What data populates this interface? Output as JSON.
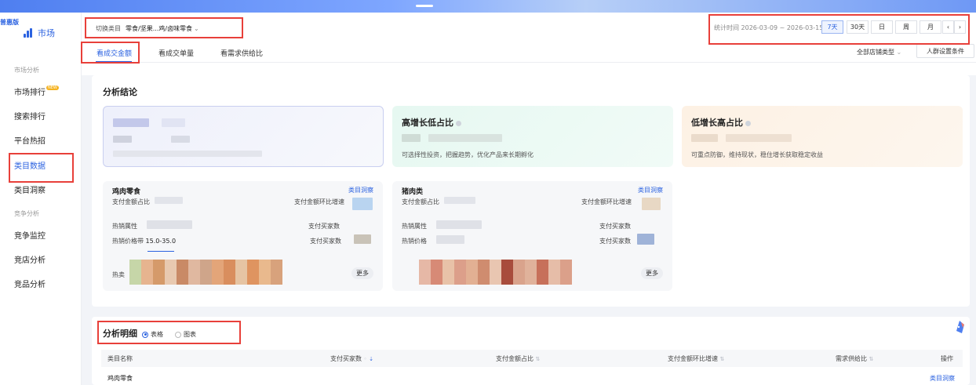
{
  "brand": {
    "tag": "普惠版",
    "name": "市场"
  },
  "sidebar": {
    "group_market": "市场分析",
    "items": [
      {
        "label": "市场排行",
        "badge": "NEW"
      },
      {
        "label": "搜索排行"
      },
      {
        "label": "平台热招"
      },
      {
        "label": "类目数据",
        "active": true
      },
      {
        "label": "类目洞察"
      }
    ],
    "group_competition": "竞争分析",
    "comp_items": [
      {
        "label": "竞争监控"
      },
      {
        "label": "竞店分析"
      },
      {
        "label": "竞品分析"
      }
    ]
  },
  "header": {
    "switch_label": "切换类目",
    "category": "零食/坚果...鸡/卤味零食",
    "time_label": "统计时间 2026-03-09 ~ 2026-03-15",
    "periods": [
      "7天",
      "30天",
      "日",
      "周",
      "月"
    ],
    "prev": "‹",
    "next": "›",
    "tabs": [
      "看成交金额",
      "看成交单量",
      "看需求供给比"
    ],
    "store_type": "全部店铺类型",
    "crowd_button": "人群设置条件"
  },
  "conclusion": {
    "title": "分析结论",
    "cards": [
      {
        "title": "",
        "desc": ""
      },
      {
        "title": "高增长低占比",
        "desc": "可选择性投资，把握趋势，优化产品来长期孵化"
      },
      {
        "title": "低增长高占比",
        "desc": "可重点防御，维持现状，稳住增长获取稳定收益"
      }
    ]
  },
  "categories": [
    {
      "name": "鸡肉零食",
      "link": "类目洞察",
      "pay_share": "支付金额占比",
      "growth": "支付金额环比增速",
      "hot_attr": "热销属性",
      "buyers": "支付买家数",
      "price_band": "热销价格带",
      "price_value": "15.0-35.0",
      "buyers2": "支付买家数",
      "hot_sell": "热卖",
      "more": "更多"
    },
    {
      "name": "猪肉类",
      "link": "类目洞察",
      "pay_share": "支付金额占比",
      "growth": "支付金额环比增速",
      "hot_attr": "热销属性",
      "buyers": "支付买家数",
      "price_band": "热销价格",
      "price_value": "",
      "buyers2": "支付买家数",
      "hot_sell": "",
      "more": "更多"
    }
  ],
  "detail": {
    "title": "分析明细",
    "view_table": "表格",
    "view_chart": "图表",
    "columns": [
      "类目名称",
      "支付买家数",
      "支付金额占比",
      "支付金额环比增速",
      "需求供给比",
      "操作"
    ],
    "rows": [
      {
        "name": "鸡肉零食",
        "action": "类目洞察"
      }
    ]
  },
  "colors": {
    "accent": "#2b62e0",
    "annotation": "#e8403a"
  }
}
